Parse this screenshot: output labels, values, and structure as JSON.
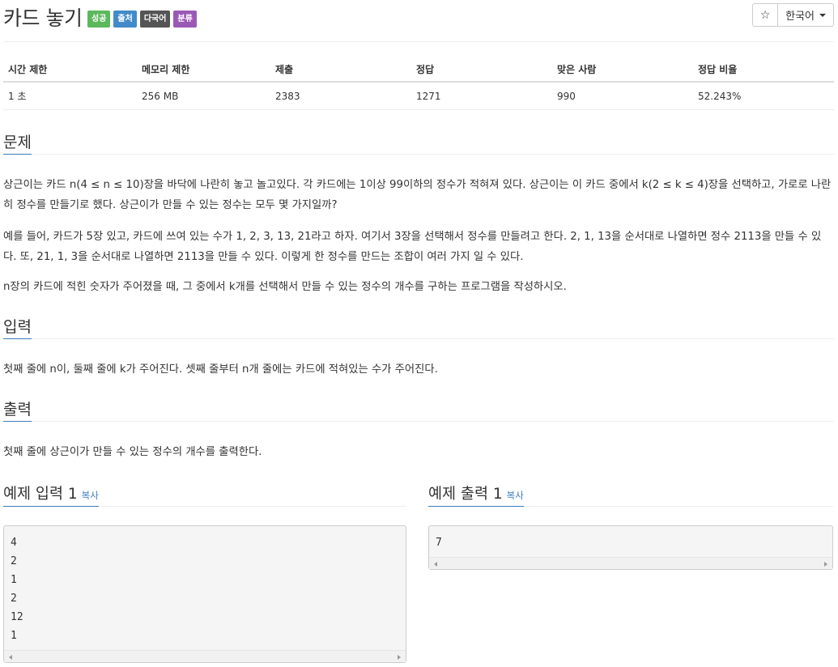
{
  "header": {
    "title": "카드 놓기",
    "labels": [
      {
        "text": "성공",
        "color": "#5cb85c"
      },
      {
        "text": "출처",
        "color": "#428bca"
      },
      {
        "text": "다국어",
        "color": "#555555"
      },
      {
        "text": "분류",
        "color": "#9b59b6"
      }
    ],
    "star_icon": "☆",
    "language": "한국어"
  },
  "info": {
    "headers": [
      "시간 제한",
      "메모리 제한",
      "제출",
      "정답",
      "맞은 사람",
      "정답 비율"
    ],
    "values": [
      "1 초",
      "256 MB",
      "2383",
      "1271",
      "990",
      "52.243%"
    ]
  },
  "problem": {
    "heading": "문제",
    "p1": "상근이는 카드 n(4 ≤ n ≤ 10)장을 바닥에 나란히 놓고 놀고있다. 각 카드에는 1이상 99이하의 정수가 적혀져 있다. 상근이는 이 카드 중에서 k(2 ≤ k ≤ 4)장을 선택하고, 가로로 나란히 정수를 만들기로 했다. 상근이가 만들 수 있는 정수는 모두 몇 가지일까?",
    "p2": "예를 들어, 카드가 5장 있고, 카드에 쓰여 있는 수가 1, 2, 3, 13, 21라고 하자. 여기서 3장을 선택해서 정수를 만들려고 한다. 2, 1, 13을 순서대로 나열하면 정수 2113을 만들 수 있다. 또, 21, 1, 3을 순서대로 나열하면 2113을 만들 수 있다. 이렇게 한 정수를 만드는 조합이 여러 가지 일 수 있다.",
    "p3": "n장의 카드에 적힌 숫자가 주어졌을 때, 그 중에서 k개를 선택해서 만들 수 있는 정수의 개수를 구하는 프로그램을 작성하시오."
  },
  "input": {
    "heading": "입력",
    "text": "첫째 줄에 n이, 둘째 줄에 k가 주어진다. 셋째 줄부터 n개 줄에는 카드에 적혀있는 수가 주어진다."
  },
  "output": {
    "heading": "출력",
    "text": "첫째 줄에 상근이가 만들 수 있는 정수의 개수를 출력한다."
  },
  "sample_input": {
    "heading": "예제 입력 1",
    "copy": "복사",
    "lines": [
      "4",
      "2",
      "1",
      "2",
      "12",
      "1"
    ]
  },
  "sample_output": {
    "heading": "예제 출력 1",
    "copy": "복사",
    "lines": [
      "7"
    ]
  }
}
